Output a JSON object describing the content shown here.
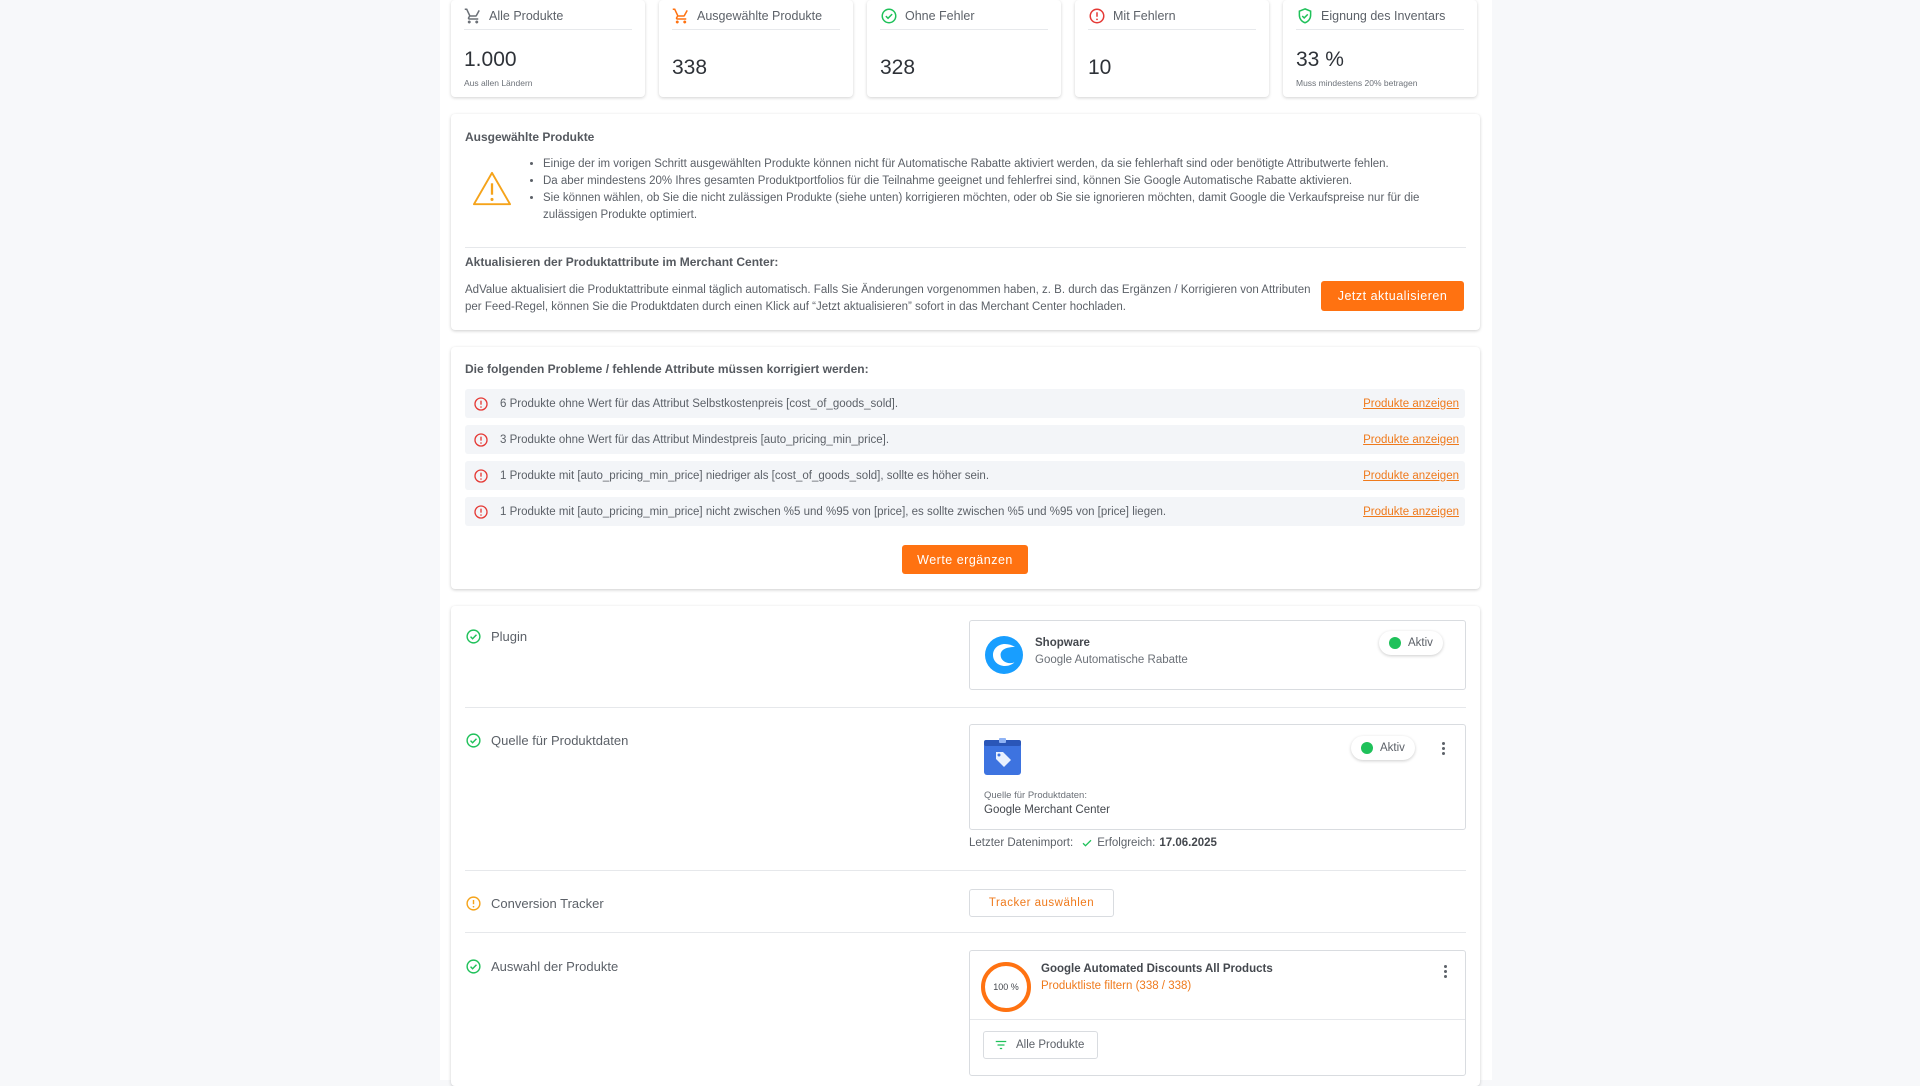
{
  "kpis": [
    {
      "icon": "cart-icon",
      "label": "Alle Produkte",
      "value": "1.000",
      "sub": "Aus allen Ländern"
    },
    {
      "icon": "cart-orange-icon",
      "label": "Ausgewählte Produkte",
      "value": "338",
      "sub": ""
    },
    {
      "icon": "check-circle-icon",
      "label": "Ohne Fehler",
      "value": "328",
      "sub": ""
    },
    {
      "icon": "error-circle-icon",
      "label": "Mit Fehlern",
      "value": "10",
      "sub": ""
    },
    {
      "icon": "shield-check-icon",
      "label": "Eignung des Inventars",
      "value": "33 %",
      "sub": "Muss mindestens 20% betragen"
    }
  ],
  "info": {
    "title": "Ausgewählte Produkte",
    "bullets": [
      "Einige der im vorigen Schritt ausgewählten Produkte können nicht für Automatische Rabatte aktiviert werden, da sie fehlerhaft sind oder benötigte Attributwerte fehlen.",
      "Da aber mindestens 20% Ihres gesamten Produktportfolios für die Teilnahme geeignet und fehlerfrei sind, können Sie Google Automatische Rabatte aktivieren.",
      "Sie können wählen, ob Sie die nicht zulässigen Produkte (siehe unten) korrigieren möchten, oder ob Sie sie ignorieren möchten, damit Google die Verkaufspreise nur für die zulässigen Produkte optimiert."
    ],
    "update_title": "Aktualisieren der Produktattribute im Merchant Center:",
    "update_text": "AdValue aktualisiert die Produktattribute einmal täglich automatisch. Falls Sie Änderungen vorgenommen haben, z. B. durch das Ergänzen / Korrigieren von Attributen per Feed-Regel, können Sie die Produktdaten durch einen Klick auf “Jetzt aktualisieren” sofort in das Merchant Center hochladen.",
    "update_button": "Jetzt aktualisieren"
  },
  "problems": {
    "title": "Die folgenden Probleme / fehlende Attribute müssen korrigiert werden:",
    "items": [
      {
        "text": "6 Produkte ohne Wert für das Attribut Selbstkostenpreis [cost_of_goods_sold].",
        "link": "Produkte anzeigen"
      },
      {
        "text": "3 Produkte ohne Wert für das Attribut Mindestpreis [auto_pricing_min_price].",
        "link": "Produkte anzeigen"
      },
      {
        "text": "1 Produkte mit [auto_pricing_min_price] niedriger als [cost_of_goods_sold], sollte es höher sein.",
        "link": "Produkte anzeigen"
      },
      {
        "text": "1 Produkte mit [auto_pricing_min_price] nicht zwischen %5 und %95 von [price], es sollte zwischen %5 und %95 von [price] liegen.",
        "link": "Produkte anzeigen"
      }
    ],
    "button": "Werte ergänzen"
  },
  "setup": {
    "plugin": {
      "label": "Plugin",
      "name": "Shopware",
      "desc": "Google Automatische Rabatte",
      "status": "Aktiv"
    },
    "source": {
      "label": "Quelle für Produktdaten",
      "caption": "Quelle für Produktdaten:",
      "value": "Google Merchant Center",
      "status": "Aktiv",
      "import_label": "Letzter Datenimport:",
      "import_status": "Erfolgreich:",
      "import_date": "17.06.2025"
    },
    "tracker": {
      "label": "Conversion Tracker",
      "button": "Tracker auswählen"
    },
    "products": {
      "label": "Auswahl der Produkte",
      "percent": "100 %",
      "progress": 1.0,
      "name": "Google Automated Discounts All Products",
      "filter_link": "Produktliste filtern (338 / 338)",
      "filter_button": "Alle Produkte"
    }
  },
  "colors": {
    "accent": "#ff7211",
    "success": "#1fc15a",
    "error": "#e53935",
    "warning": "#f5a31a"
  }
}
